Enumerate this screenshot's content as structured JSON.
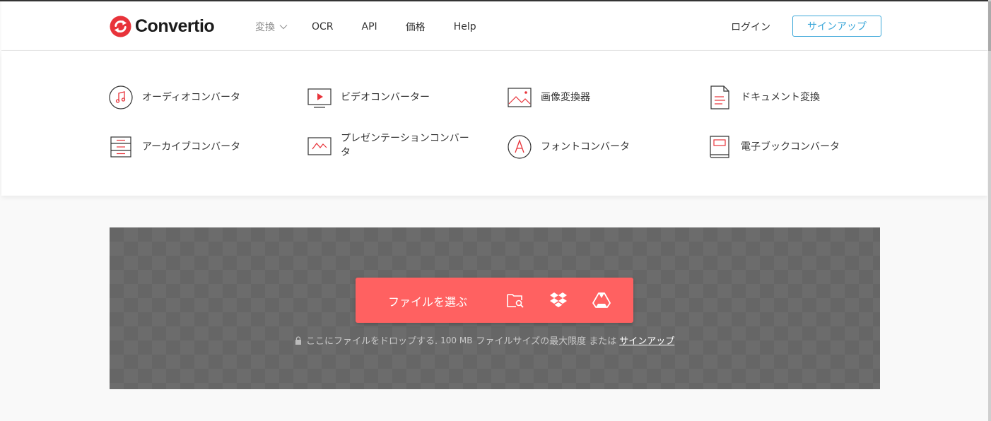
{
  "header": {
    "logo_text": "Convertio",
    "nav": {
      "convert": "変換",
      "ocr": "OCR",
      "api": "API",
      "pricing": "価格",
      "help": "Help"
    },
    "login": "ログイン",
    "signup": "サインアップ"
  },
  "menu": {
    "audio": "オーディオコンバータ",
    "video": "ビデオコンバーター",
    "image": "画像変換器",
    "document": "ドキュメント変換",
    "archive": "アーカイブコンバータ",
    "presentation": "プレゼンテーションコンバータ",
    "font": "フォントコンバータ",
    "ebook": "電子ブックコンバータ"
  },
  "upload": {
    "choose_label": "ファイルを選ぶ",
    "hint_text": "ここにファイルをドロップする.",
    "size_text": "100 MB",
    "limit_text": "ファイルサイズの最大限度 または",
    "signup_link": "サインアップ"
  },
  "colors": {
    "brand_red": "#ff6161",
    "accent_blue": "#3ca7d9",
    "icon_red": "#e8333a",
    "upload_bg": "#666666"
  },
  "icons": {
    "logo": "convertio-logo-icon",
    "chevron": "chevron-down-icon",
    "audio": "music-note-icon",
    "video": "video-play-icon",
    "image": "image-icon",
    "document": "document-icon",
    "archive": "archive-icon",
    "presentation": "presentation-icon",
    "font": "font-icon",
    "ebook": "ebook-icon",
    "folder": "folder-search-icon",
    "dropbox": "dropbox-icon",
    "gdrive": "google-drive-icon",
    "lock": "lock-icon"
  }
}
